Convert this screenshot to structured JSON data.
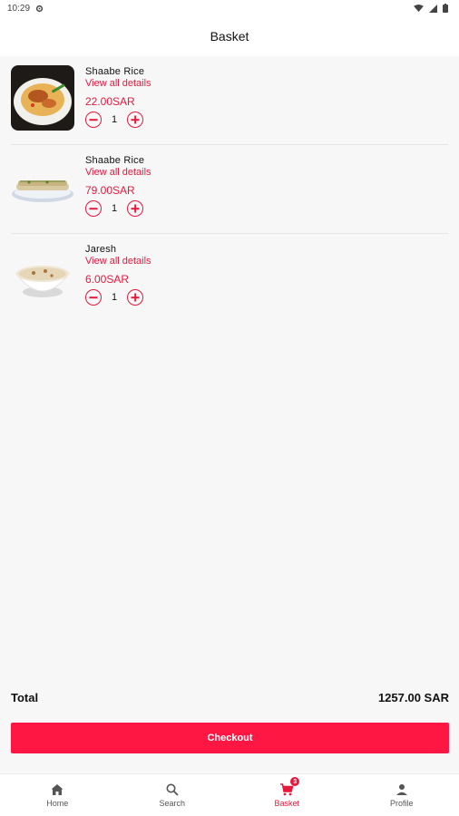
{
  "status_bar": {
    "time": "10:29"
  },
  "app_bar": {
    "title": "Basket"
  },
  "basket": {
    "items": [
      {
        "name": "Shaabe Rice",
        "details_link": "View all details",
        "price": "22.00SAR",
        "quantity": "1",
        "image": "rice-dish-photo"
      },
      {
        "name": "Shaabe Rice",
        "details_link": "View all details",
        "price": "79.00SAR",
        "quantity": "1",
        "image": "rolled-bread-plate-photo"
      },
      {
        "name": "Jaresh",
        "details_link": "View all details",
        "price": "6.00SAR",
        "quantity": "1",
        "image": "porridge-bowl-photo"
      }
    ]
  },
  "summary": {
    "total_label": "Total",
    "total_value": "1257.00 SAR"
  },
  "checkout": {
    "label": "Checkout"
  },
  "bottom_nav": {
    "items": [
      {
        "label": "Home",
        "icon": "home-icon"
      },
      {
        "label": "Search",
        "icon": "search-icon"
      },
      {
        "label": "Basket",
        "icon": "cart-icon",
        "badge": "3",
        "active": true
      },
      {
        "label": "Profile",
        "icon": "person-icon"
      }
    ]
  },
  "colors": {
    "accent": "#e8173c",
    "checkout_button": "#ff1744",
    "background": "#f7f7f7"
  }
}
